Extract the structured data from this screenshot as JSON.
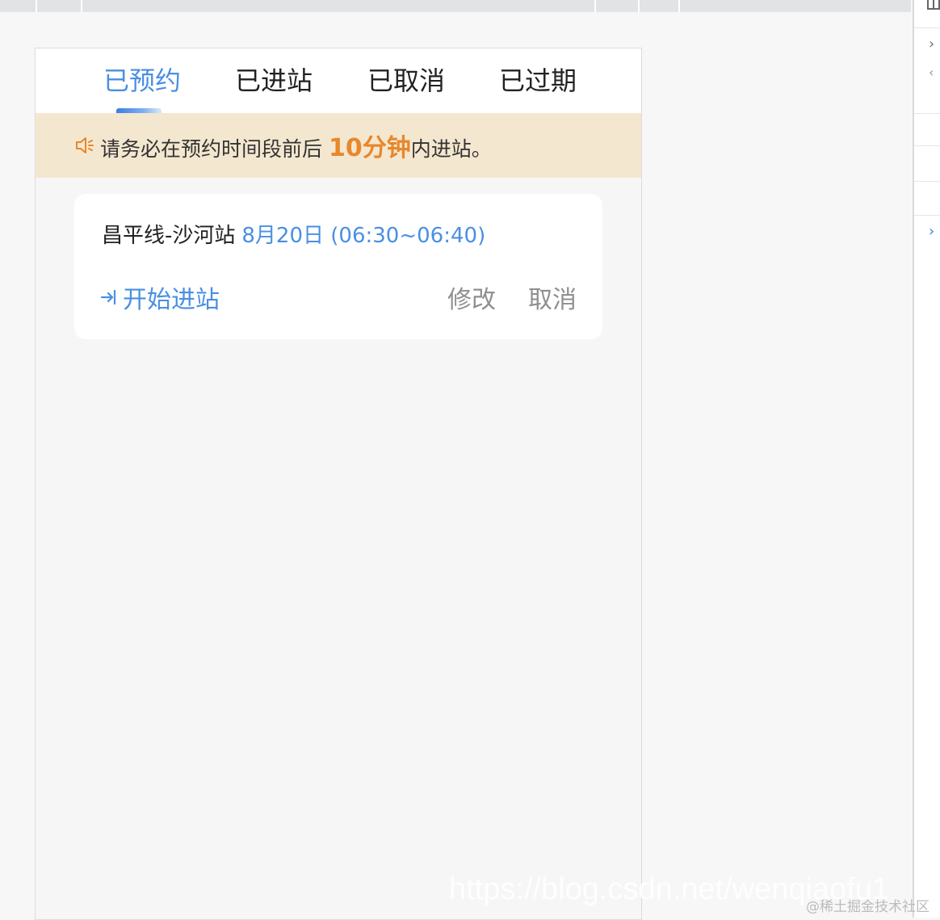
{
  "tabs": [
    {
      "label": "已预约"
    },
    {
      "label": "已进站"
    },
    {
      "label": "已取消"
    },
    {
      "label": "已过期"
    }
  ],
  "notice": {
    "icon": "speaker-icon",
    "prefix": "请务必在预约时间段前后 ",
    "highlight": "10分钟",
    "suffix": "内进站。",
    "highlight_color": "#e8872b"
  },
  "reservation": {
    "station": "昌平线-沙河站",
    "datetime": "8月20日 (06:30~06:40)",
    "enter_label": "开始进站",
    "modify_label": "修改",
    "cancel_label": "取消"
  },
  "colors": {
    "accent": "#4a8fe2",
    "notice_bg": "#f4e7cf"
  },
  "watermark": {
    "url": "https://blog.csdn.net/wenqiaofu1",
    "site": "@稀土掘金技术社区"
  }
}
